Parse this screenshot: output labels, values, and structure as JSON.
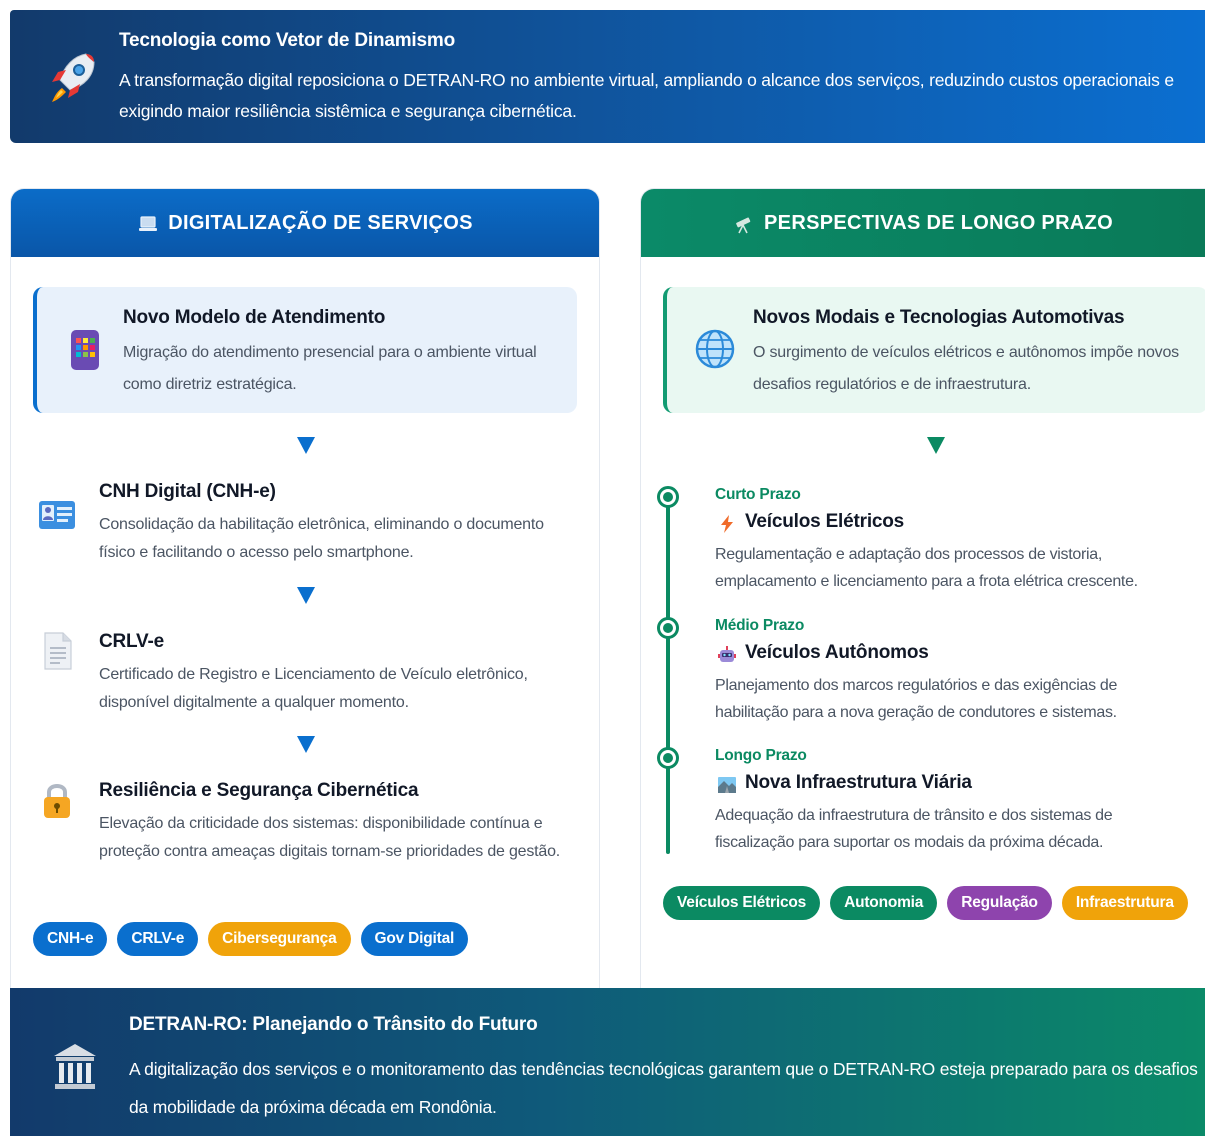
{
  "banner": {
    "icon": "rocket-icon",
    "title": "Tecnologia como Vetor de Dinamismo",
    "text": "A transformação digital reposiciona o DETRAN-RO no ambiente virtual, ampliando o alcance dos serviços, reduzindo custos operacionais e exigindo maior resiliência sistêmica e segurança cibernética."
  },
  "left": {
    "header": "DIGITALIZAÇÃO DE SERVIÇOS",
    "header_icon": "laptop-icon",
    "highlight": {
      "icon": "smartphone-apps-icon",
      "title": "Novo Modelo de Atendimento",
      "text": "Migração do atendimento presencial para o ambiente virtual como diretriz estratégica."
    },
    "steps": [
      {
        "icon": "id-card-icon",
        "title": "CNH Digital (CNH-e)",
        "text": "Consolidação da habilitação eletrônica, eliminando o documento físico e facilitando o acesso pelo smartphone."
      },
      {
        "icon": "document-icon",
        "title": "CRLV-e",
        "text": "Certificado de Registro e Licenciamento de Veículo eletrônico, disponível digitalmente a qualquer momento."
      },
      {
        "icon": "lock-icon",
        "title": "Resiliência e Segurança Cibernética",
        "text": "Elevação da criticidade dos sistemas: disponibilidade contínua e proteção contra ameaças digitais tornam-se prioridades de gestão."
      }
    ],
    "tags": [
      {
        "label": "CNH-e",
        "color": "#0a6fce"
      },
      {
        "label": "CRLV-e",
        "color": "#0a6fce"
      },
      {
        "label": "Cibersegurança",
        "color": "#f0a30a"
      },
      {
        "label": "Gov Digital",
        "color": "#0a6fce"
      }
    ]
  },
  "right": {
    "header": "PERSPECTIVAS DE LONGO PRAZO",
    "header_icon": "telescope-icon",
    "highlight": {
      "icon": "globe-icon",
      "title": "Novos Modais e Tecnologias Automotivas",
      "text": "O surgimento de veículos elétricos e autônomos impõe novos desafios regulatórios e de infraestrutura."
    },
    "timeline": [
      {
        "period": "Curto Prazo",
        "icon": "lightning-icon",
        "title": "Veículos Elétricos",
        "text": "Regulamentação e adaptação dos processos de vistoria, emplacamento e licenciamento para a frota elétrica crescente."
      },
      {
        "period": "Médio Prazo",
        "icon": "robot-icon",
        "title": "Veículos Autônomos",
        "text": "Planejamento dos marcos regulatórios e das exigências de habilitação para a nova geração de condutores e sistemas."
      },
      {
        "period": "Longo Prazo",
        "icon": "road-landscape-icon",
        "title": "Nova Infraestrutura Viária",
        "text": "Adequação da infraestrutura de trânsito e dos sistemas de fiscalização para suportar os modais da próxima década."
      }
    ],
    "tags": [
      {
        "label": "Veículos Elétricos",
        "color": "#0b8a62"
      },
      {
        "label": "Autonomia",
        "color": "#0b8a62"
      },
      {
        "label": "Regulação",
        "color": "#8e44ad"
      },
      {
        "label": "Infraestrutura",
        "color": "#f0a30a"
      }
    ]
  },
  "footer": {
    "icon": "classical-building-icon",
    "title": "DETRAN-RO: Planejando o Trânsito do Futuro",
    "text": "A digitalização dos serviços e o monitoramento das tendências tecnológicas garantem que o DETRAN-RO esteja preparado para os desafios da mobilidade da próxima década em Rondônia."
  }
}
